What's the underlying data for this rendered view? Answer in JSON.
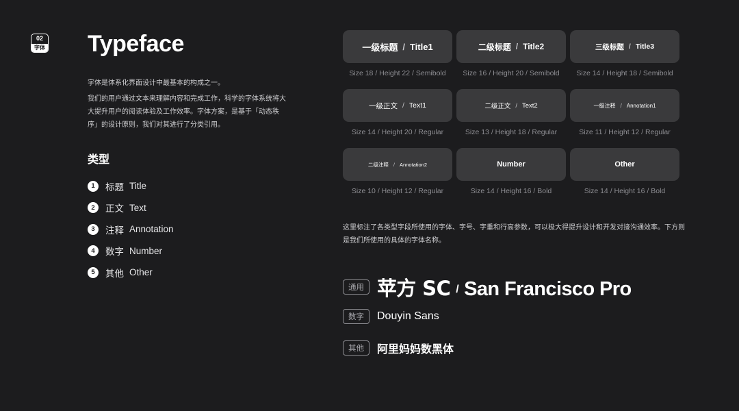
{
  "badge": {
    "number": "02",
    "label": "字体"
  },
  "title": "Typeface",
  "intro": {
    "p1": "字体是体系化界面设计中最基本的构成之一。",
    "p2": "我们的用户通过文本来理解内容和完成工作，科学的字体系统将大大提升用户的阅读体验及工作效率。字体方案，是基于「动态秩序」的设计原则，我们对其进行了分类引用。"
  },
  "types": {
    "heading": "类型",
    "items": [
      {
        "num": "1",
        "zh": "标题",
        "en": "Title"
      },
      {
        "num": "2",
        "zh": "正文",
        "en": "Text"
      },
      {
        "num": "3",
        "zh": "注释",
        "en": "Annotation"
      },
      {
        "num": "4",
        "zh": "数字",
        "en": "Number"
      },
      {
        "num": "5",
        "zh": "其他",
        "en": "Other"
      }
    ]
  },
  "styles": [
    {
      "zh": "一级标题",
      "sep": "/",
      "en": "Title1",
      "spec": "Size 18 / Height 22 / Semibold"
    },
    {
      "zh": "二级标题",
      "sep": "/",
      "en": "Title2",
      "spec": "Size 16 / Height 20 / Semibold"
    },
    {
      "zh": "三级标题",
      "sep": "/",
      "en": "Title3",
      "spec": "Size 14 / Height 18 / Semibold"
    },
    {
      "zh": "一级正文",
      "sep": "/",
      "en": "Text1",
      "spec": "Size 14 / Height 20 / Regular"
    },
    {
      "zh": "二级正文",
      "sep": "/",
      "en": "Text2",
      "spec": "Size 13 / Height 18 / Regular"
    },
    {
      "zh": "一级注释",
      "sep": "/",
      "en": "Annotation1",
      "spec": "Size 11 / Height 12 / Regular"
    },
    {
      "zh": "二级注释",
      "sep": "/",
      "en": "Annotation2",
      "spec": "Size 10 / Height 12 / Regular"
    },
    {
      "zh": "",
      "sep": "",
      "en": "Number",
      "spec": "Size 14 / Height 16 / Bold"
    },
    {
      "zh": "",
      "sep": "",
      "en": "Other",
      "spec": "Size 14 / Height 16 / Bold"
    }
  ],
  "note": "这里标注了各类型字段所使用的字体、字号、字重和行高参数，可以极大得提升设计和开发对接沟通效率。下方则是我们所使用的具体的字体名称。",
  "fonts": [
    {
      "tag": "通用",
      "name_zh": "苹方 SC",
      "sep": "/",
      "name_en": "San Francisco Pro"
    },
    {
      "tag": "数字",
      "name": "Douyin Sans"
    },
    {
      "tag": "其他",
      "name": "阿里妈妈数黑体"
    }
  ]
}
